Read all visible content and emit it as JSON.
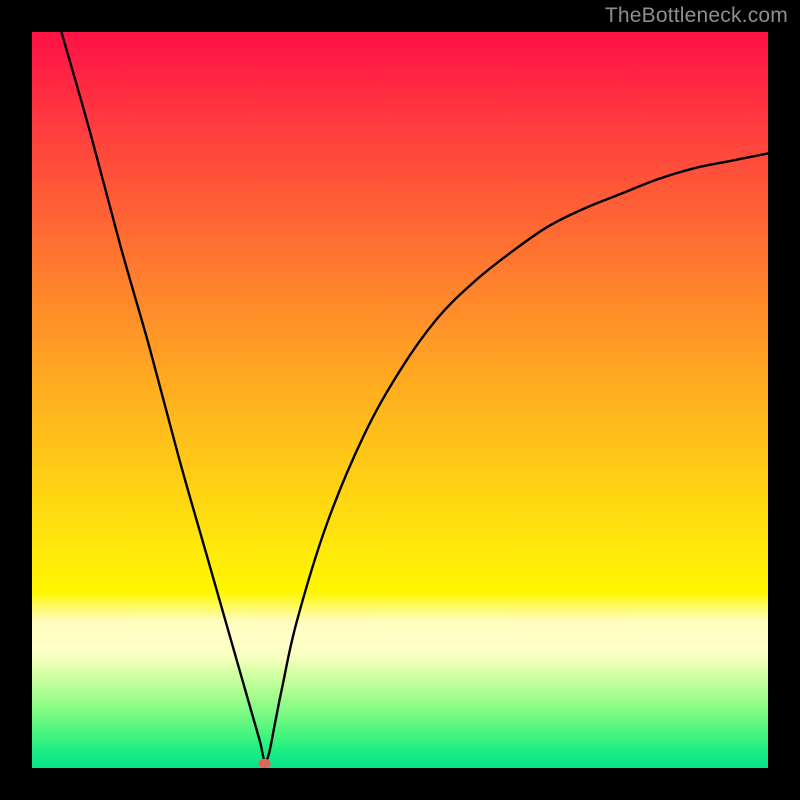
{
  "watermark": {
    "text": "TheBottleneck.com"
  },
  "colors": {
    "frame": "#000000",
    "curve": "#000000",
    "marker": "#d96a5a",
    "gradient_top": "#ff1245",
    "gradient_mid": "#fff600",
    "gradient_bottom": "#07e38a"
  },
  "chart_data": {
    "type": "line",
    "title": "",
    "subtitle": "",
    "xlabel": "",
    "ylabel": "",
    "xlim": [
      0,
      100
    ],
    "ylim": [
      0,
      100
    ],
    "grid": false,
    "legend": false,
    "series": [
      {
        "name": "bottleneck-curve",
        "x": [
          4,
          8,
          12,
          16,
          20,
          24,
          28,
          30,
          31,
          31.6,
          32.2,
          33,
          34,
          36,
          40,
          45,
          50,
          55,
          60,
          65,
          70,
          75,
          80,
          85,
          90,
          95,
          100
        ],
        "y": [
          100,
          86,
          71,
          57,
          42,
          28,
          14,
          7,
          3.5,
          1,
          2,
          6,
          11,
          20,
          33,
          45,
          54,
          61,
          66,
          70,
          73.5,
          76,
          78,
          80,
          81.5,
          82.5,
          83.5
        ]
      }
    ],
    "annotations": [
      {
        "name": "min-marker",
        "x": 31.6,
        "y": 0.6,
        "shape": "dot"
      }
    ],
    "notes": "No axes, ticks, or gridlines are drawn. Background is a vertical red→yellow→green gradient. Values estimated from pixel positions; y is percentage-like (0 bottom, 100 top)."
  }
}
